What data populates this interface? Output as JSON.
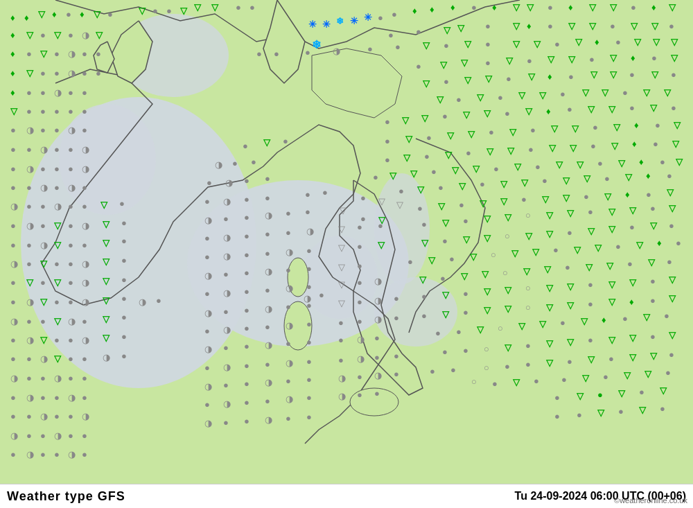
{
  "title_left": "Weather type  GFS",
  "title_right": "Tu 24-09-2024 06:00 UTC (00+06)",
  "watermark": "©weatheronline.co.uk",
  "map": {
    "bg_land_color": "#c8e6a0",
    "bg_sea_color": "#d0d8e0",
    "symbol_green_arrow": "▽",
    "symbol_gray_circle": "●",
    "symbol_half_circle": "◑"
  }
}
